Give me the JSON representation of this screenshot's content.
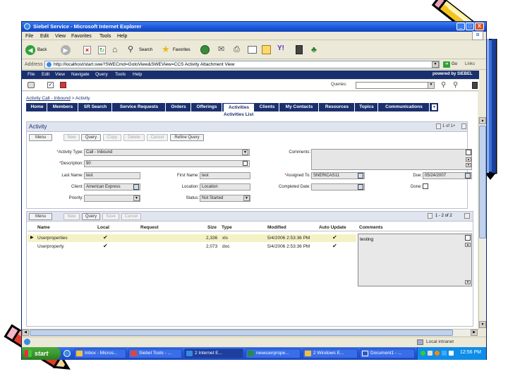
{
  "window": {
    "title": "Siebel Service - Microsoft Internet Explorer",
    "controls": [
      "_",
      "□",
      "X"
    ]
  },
  "ie_menu": [
    "File",
    "Edit",
    "View",
    "Favorites",
    "Tools",
    "Help"
  ],
  "ie_toolbar": {
    "back_label": "Back",
    "search_label": "Search",
    "favorites_label": "Favorites"
  },
  "address": {
    "label": "Address",
    "url": "http://localhost/start.swe?SWECmd=GotoView&SWEView=CCS Activity Attachment View",
    "go_label": "Go",
    "links_label": "Links"
  },
  "siebel_menu": [
    "File",
    "Edit",
    "View",
    "Navigate",
    "Query",
    "Tools",
    "Help"
  ],
  "brand": "powered by SIEBEL",
  "queries": {
    "label": "Queries:",
    "value": ""
  },
  "breadcrumb": [
    "Activity Call - Inbound",
    "> Activity"
  ],
  "tabs": [
    {
      "label": "Home",
      "active": false
    },
    {
      "label": "Members",
      "active": false
    },
    {
      "label": "SR Search",
      "active": false
    },
    {
      "label": "Service Requests",
      "active": false
    },
    {
      "label": "Orders",
      "active": false
    },
    {
      "label": "Offerings",
      "active": false
    },
    {
      "label": "Activities",
      "active": true
    },
    {
      "label": "Clients",
      "active": false
    },
    {
      "label": "My Contacts",
      "active": false
    },
    {
      "label": "Resources",
      "active": false
    },
    {
      "label": "Topics",
      "active": false
    },
    {
      "label": "Communications",
      "active": false
    }
  ],
  "subview_link": "Activities List",
  "activity": {
    "title": "Activity",
    "record_count": "1 of 1+",
    "buttons": {
      "menu": "Menu",
      "new": "New",
      "query": "Query",
      "copy": "Copy",
      "delete": "Delete",
      "cancel": "Cancel",
      "refine_query": "Refine Query"
    },
    "fields": {
      "activity_type_label": "Activity Type:",
      "activity_type_value": "Call - Inbound",
      "description_label": "Description:",
      "description_value": "90",
      "last_name_label": "Last Name:",
      "last_name_value": "test",
      "first_name_label": "First Name:",
      "first_name_value": "test",
      "client_label": "Client:",
      "client_value": "American Express",
      "location_label": "Location:",
      "location_value": "Location",
      "priority_label": "Priority:",
      "priority_value": "",
      "status_label": "Status:",
      "status_value": "Not Started",
      "comments_label": "Comments:",
      "comments_value": "",
      "assigned_to_label": "Assigned To:",
      "assigned_to_value": "SNERICAS11",
      "due_label": "Due:",
      "due_value": "05/24/2007",
      "completed_date_label": "Completed Date:",
      "completed_date_value": "",
      "done_label": "Done:"
    }
  },
  "attachments": {
    "buttons": {
      "menu": "Menu",
      "new": "New",
      "query": "Query",
      "save": "Save",
      "cancel": "Cancel"
    },
    "record_count": "1 - 2 of 2",
    "columns": [
      "Name",
      "Local",
      "Request",
      "Size",
      "Type",
      "Modified",
      "Auto Update",
      "Comments"
    ],
    "rows": [
      {
        "name": "Userproperties",
        "local": true,
        "size": "2,336",
        "type": "xls",
        "modified": "5/4/2006 2:53:36 PM",
        "auto_update": true,
        "selected": true
      },
      {
        "name": "Userproperty",
        "local": true,
        "size": "2,073",
        "type": "doc",
        "modified": "5/4/2006 2:53:36 PM",
        "auto_update": true,
        "selected": false
      }
    ],
    "comment_text": "testing"
  },
  "status_bar": {
    "zone": "Local intranet"
  },
  "taskbar": {
    "start_label": "start",
    "items": [
      "Inbox - Micros...",
      "Siebel Tools - ...",
      "2 Internet E...",
      "newuserprope...",
      "2 Windows E...",
      "Document1 - ..."
    ],
    "clock": "12:56 PM"
  },
  "colors": {
    "xp_title": "#1a54d9",
    "siebel_navy": "#1a2f6e",
    "tab_active": "#ffffff",
    "selected_row": "#f4f2c4",
    "taskbar": "#2458d6",
    "start_green": "#3a9b2f"
  }
}
